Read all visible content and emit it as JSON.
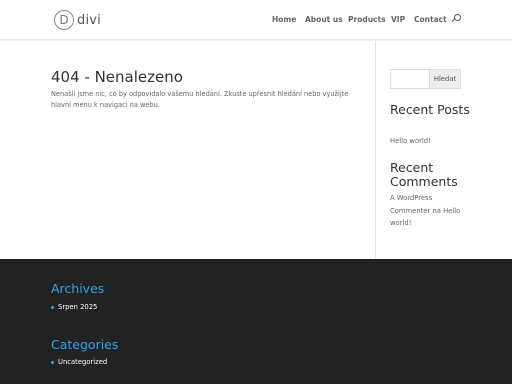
{
  "header": {
    "logo_mark": "D",
    "logo_text": "divi",
    "nav": [
      {
        "label": "Home"
      },
      {
        "label": "About us"
      },
      {
        "label": "Products"
      },
      {
        "label": "VIP"
      },
      {
        "label": "Contact"
      }
    ],
    "search_icon": "search-icon"
  },
  "main": {
    "title": "404 - Nenalezeno",
    "message": "Nenašli jsme nic, co by odpovídalo vašemu hledání. Zkuste upřesnit hledání nebo využijte hlavní menu k navigaci na webu."
  },
  "sidebar": {
    "search": {
      "placeholder": "",
      "button_label": "Hledat"
    },
    "recent_posts": {
      "title": "Recent Posts",
      "items": [
        "Hello world!"
      ]
    },
    "recent_comments": {
      "title": "Recent Comments",
      "items": [
        {
          "author": "A WordPress Commenter",
          "connector": "na",
          "post": "Hello world!"
        }
      ]
    }
  },
  "footer": {
    "archives": {
      "title": "Archives",
      "items": [
        "Srpen 2025"
      ]
    },
    "categories": {
      "title": "Categories",
      "items": [
        "Uncategorized"
      ]
    }
  },
  "colors": {
    "accent": "#2ea3f2",
    "footer_bg": "#222222",
    "text": "#666666",
    "heading": "#333333"
  }
}
